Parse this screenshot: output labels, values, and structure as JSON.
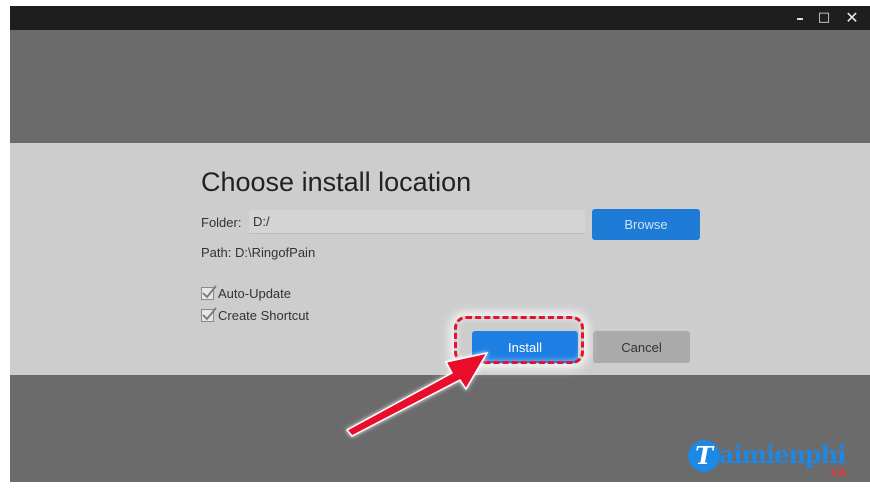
{
  "window": {
    "controls": {
      "minimize": "–",
      "maximize": "□",
      "close": "✕"
    }
  },
  "dialog": {
    "title": "Choose install location",
    "folder": {
      "label": "Folder:",
      "value": "D:/"
    },
    "browse_label": "Browse",
    "path_text": "Path: D:\\RingofPain",
    "checkboxes": [
      {
        "label": "Auto-Update",
        "checked": true
      },
      {
        "label": "Create Shortcut",
        "checked": true
      }
    ],
    "install_label": "Install",
    "cancel_label": "Cancel"
  },
  "annotation": {
    "highlight_target": "Install",
    "color": "#e8102a"
  },
  "watermark": {
    "logo_letter": "T",
    "text": "aimienphi",
    "tld": ".vn"
  },
  "colors": {
    "primary_button": "#1d7fe3",
    "browse_button": "#1e7bd6",
    "cancel_button": "#aaaaaa",
    "panel": "#cdcdcd",
    "window_bg": "#6b6b6b",
    "titlebar": "#1e1e1e"
  }
}
